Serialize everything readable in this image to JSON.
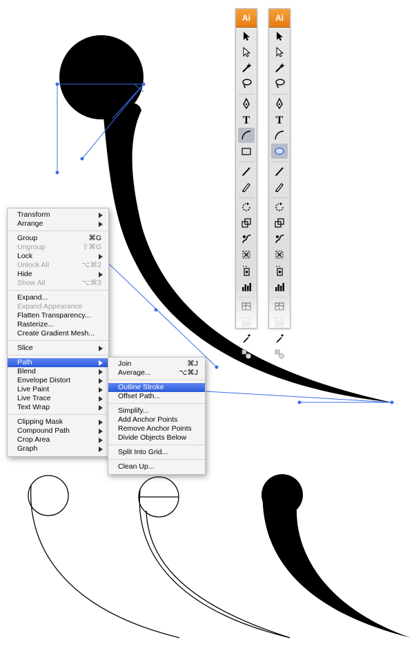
{
  "toolbars": [
    {
      "logo": "Ai",
      "tools": [
        {
          "icon": "selection-arrow-icon",
          "selected": false
        },
        {
          "icon": "direct-selection-arrow-icon",
          "selected": false
        },
        {
          "icon": "magic-wand-icon",
          "selected": false
        },
        {
          "icon": "lasso-icon",
          "selected": false
        },
        {
          "icon": "pen-icon",
          "selected": false
        },
        {
          "icon": "type-icon",
          "selected": false
        },
        {
          "icon": "arc-icon",
          "selected": true
        },
        {
          "icon": "rectangle-icon",
          "selected": false
        },
        {
          "icon": "paintbrush-icon",
          "selected": false
        },
        {
          "icon": "pencil-icon",
          "selected": false
        },
        {
          "icon": "rotate-icon",
          "selected": false
        },
        {
          "icon": "scale-icon",
          "selected": false
        },
        {
          "icon": "warp-icon",
          "selected": false
        },
        {
          "icon": "free-transform-icon",
          "selected": false
        },
        {
          "icon": "symbol-sprayer-icon",
          "selected": false
        },
        {
          "icon": "column-graph-icon",
          "selected": false
        },
        {
          "icon": "mesh-icon",
          "selected": false
        },
        {
          "icon": "gradient-icon",
          "selected": false
        },
        {
          "icon": "eyedropper-icon",
          "selected": false
        },
        {
          "icon": "blend-icon",
          "selected": false
        }
      ]
    },
    {
      "logo": "Ai",
      "tools": [
        {
          "icon": "selection-arrow-icon",
          "selected": false
        },
        {
          "icon": "direct-selection-arrow-icon",
          "selected": false
        },
        {
          "icon": "magic-wand-icon",
          "selected": false
        },
        {
          "icon": "lasso-icon",
          "selected": false
        },
        {
          "icon": "pen-icon",
          "selected": false
        },
        {
          "icon": "type-icon",
          "selected": false
        },
        {
          "icon": "arc-icon",
          "selected": false
        },
        {
          "icon": "ellipse-icon",
          "selected": true
        },
        {
          "icon": "paintbrush-icon",
          "selected": false
        },
        {
          "icon": "pencil-icon",
          "selected": false
        },
        {
          "icon": "rotate-icon",
          "selected": false
        },
        {
          "icon": "scale-icon",
          "selected": false
        },
        {
          "icon": "warp-icon",
          "selected": false
        },
        {
          "icon": "free-transform-icon",
          "selected": false
        },
        {
          "icon": "symbol-sprayer-icon",
          "selected": false
        },
        {
          "icon": "column-graph-icon",
          "selected": false
        },
        {
          "icon": "mesh-icon",
          "selected": false
        },
        {
          "icon": "gradient-icon",
          "selected": false
        },
        {
          "icon": "eyedropper-icon",
          "selected": false
        },
        {
          "icon": "blend-icon",
          "selected": false
        }
      ]
    }
  ],
  "object_menu": [
    {
      "label": "Transform",
      "submenu": true
    },
    {
      "label": "Arrange",
      "submenu": true
    },
    {
      "sep": true
    },
    {
      "label": "Group",
      "shortcut": "⌘G"
    },
    {
      "label": "Ungroup",
      "shortcut": "⇧⌘G",
      "disabled": true
    },
    {
      "label": "Lock",
      "submenu": true
    },
    {
      "label": "Unlock All",
      "shortcut": "⌥⌘2",
      "disabled": true
    },
    {
      "label": "Hide",
      "submenu": true
    },
    {
      "label": "Show All",
      "shortcut": "⌥⌘3",
      "disabled": true
    },
    {
      "sep": true
    },
    {
      "label": "Expand..."
    },
    {
      "label": "Expand Appearance",
      "disabled": true
    },
    {
      "label": "Flatten Transparency..."
    },
    {
      "label": "Rasterize..."
    },
    {
      "label": "Create Gradient Mesh..."
    },
    {
      "sep": true
    },
    {
      "label": "Slice",
      "submenu": true
    },
    {
      "sep": true
    },
    {
      "label": "Path",
      "submenu": true,
      "highlighted": true
    },
    {
      "label": "Blend",
      "submenu": true
    },
    {
      "label": "Envelope Distort",
      "submenu": true
    },
    {
      "label": "Live Paint",
      "submenu": true
    },
    {
      "label": "Live Trace",
      "submenu": true
    },
    {
      "label": "Text Wrap",
      "submenu": true
    },
    {
      "sep": true
    },
    {
      "label": "Clipping Mask",
      "submenu": true
    },
    {
      "label": "Compound Path",
      "submenu": true
    },
    {
      "label": "Crop Area",
      "submenu": true
    },
    {
      "label": "Graph",
      "submenu": true
    }
  ],
  "path_submenu": [
    {
      "label": "Join",
      "shortcut": "⌘J"
    },
    {
      "label": "Average...",
      "shortcut": "⌥⌘J"
    },
    {
      "sep": true
    },
    {
      "label": "Outline Stroke",
      "highlighted": true
    },
    {
      "label": "Offset Path..."
    },
    {
      "sep": true
    },
    {
      "label": "Simplify..."
    },
    {
      "label": "Add Anchor Points"
    },
    {
      "label": "Remove Anchor Points"
    },
    {
      "label": "Divide Objects Below"
    },
    {
      "sep": true
    },
    {
      "label": "Split Into Grid..."
    },
    {
      "sep": true
    },
    {
      "label": "Clean Up..."
    }
  ],
  "colors": {
    "selection": "#3a6ee8",
    "highlight": "#2a58d8",
    "shape": "#000000"
  }
}
